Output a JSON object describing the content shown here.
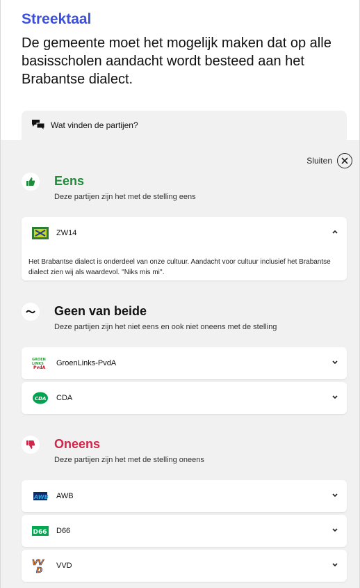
{
  "header": {
    "title": "Streektaal",
    "statement": "De gemeente moet het mogelijk maken dat op alle basisscholen aandacht wordt besteed aan het Brabantse dialect."
  },
  "tab": {
    "label": "Wat vinden de partijen?",
    "icon": "chat-bubbles-icon"
  },
  "close": {
    "label": "Sluiten",
    "icon": "close-circle-icon"
  },
  "sections": {
    "agree": {
      "title": "Eens",
      "subtitle": "Deze partijen zijn het met de stelling eens",
      "color": "#1e8a3a",
      "icon": "thumbs-up-icon",
      "parties": [
        {
          "name": "ZW14",
          "expanded": true,
          "text": "Het Brabantse dialect is onderdeel van onze cultuur. Aandacht voor cultuur inclusief het Brabantse dialect zien wij als waardevol. ''Niks mis mi''."
        }
      ]
    },
    "neutral": {
      "title": "Geen van beide",
      "subtitle": "Deze partijen zijn het niet eens en ook niet oneens met de stelling",
      "color": "#111111",
      "icon": "tilde-icon",
      "parties": [
        {
          "name": "GroenLinks-PvdA",
          "logo_text": "GROEN LINKS PvdA"
        },
        {
          "name": "CDA",
          "logo_text": "CDA"
        }
      ]
    },
    "disagree": {
      "title": "Oneens",
      "subtitle": "Deze partijen zijn het met de stelling oneens",
      "color": "#d0264a",
      "icon": "thumbs-down-icon",
      "parties": [
        {
          "name": "AWB",
          "logo_text": "AWB"
        },
        {
          "name": "D66",
          "logo_text": "D66"
        },
        {
          "name": "VVD",
          "logo_text": "VVD"
        }
      ]
    }
  }
}
